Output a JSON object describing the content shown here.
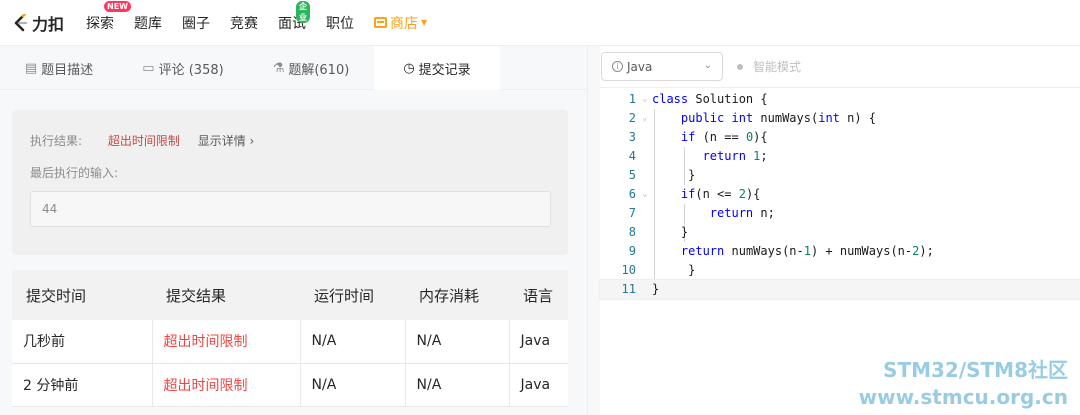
{
  "nav": {
    "logo_text": "力扣",
    "items": [
      {
        "label": "探索",
        "badge": "NEW"
      },
      {
        "label": "题库"
      },
      {
        "label": "圈子"
      },
      {
        "label": "竞赛"
      },
      {
        "label": "面试",
        "badge": "企业"
      },
      {
        "label": "职位"
      }
    ],
    "store_label": "商店"
  },
  "tabs": [
    {
      "label": "题目描述",
      "icon": "doc-icon"
    },
    {
      "label": "评论 (358)",
      "icon": "comment-icon"
    },
    {
      "label": "题解(610)",
      "icon": "flask-icon"
    },
    {
      "label": "提交记录",
      "icon": "clock-icon",
      "active": true
    }
  ],
  "result": {
    "label": "执行结果:",
    "status": "超出时间限制",
    "detail_link": "显示详情 ›",
    "last_input_label": "最后执行的输入:",
    "last_input_value": "44"
  },
  "table": {
    "headers": [
      "提交时间",
      "提交结果",
      "运行时间",
      "内存消耗",
      "语言"
    ],
    "rows": [
      [
        "几秒前",
        "超出时间限制",
        "N/A",
        "N/A",
        "Java"
      ],
      [
        "2 分钟前",
        "超出时间限制",
        "N/A",
        "N/A",
        "Java"
      ]
    ]
  },
  "editor": {
    "language": "Java",
    "smart_mode": "智能模式",
    "code_lines": [
      "class Solution {",
      "    public int numWays(int n) {",
      "    if (n == 0){",
      "       return 1;",
      "     }",
      "    if(n <= 2){",
      "        return n;",
      "    }",
      "    return numWays(n-1) + numWays(n-2);",
      "     }",
      "}"
    ]
  },
  "watermark": {
    "line1": "STM32/STM8社区",
    "line2": "www.stmcu.org.cn"
  },
  "colors": {
    "accent": "#ffa116",
    "error": "#ef4743",
    "new_badge": "#ff375f",
    "enterprise_badge": "#2db55d"
  }
}
